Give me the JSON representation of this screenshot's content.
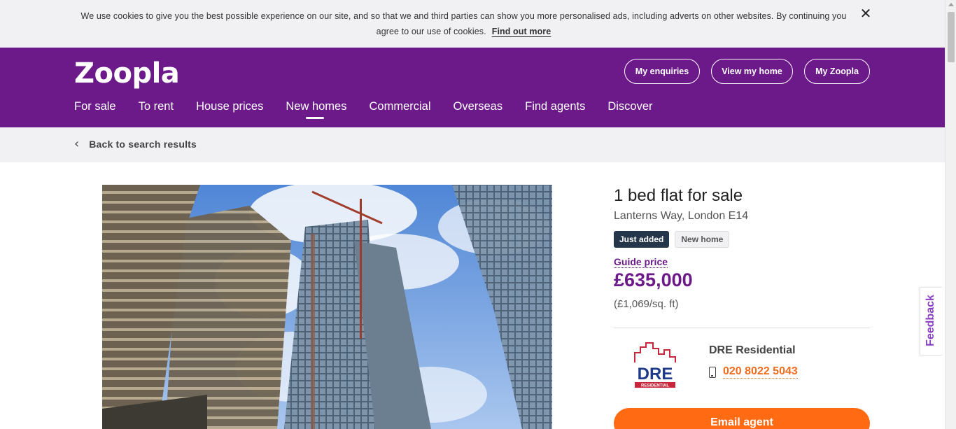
{
  "cookie": {
    "text": "We use cookies to give you the best possible experience on our site, and so that we and third parties can show you more personalised ads, including adverts on other websites. By continuing you agree to our use of cookies.",
    "link": "Find out more",
    "close": "✕"
  },
  "header": {
    "logo": "Zoopla",
    "buttons": [
      "My enquiries",
      "View my home",
      "My Zoopla"
    ],
    "nav": [
      "For sale",
      "To rent",
      "House prices",
      "New homes",
      "Commercial",
      "Overseas",
      "Find agents",
      "Discover"
    ],
    "active_nav": "New homes"
  },
  "breadcrumb": {
    "label": "Back to search results",
    "icon": "chevron-left-icon"
  },
  "listing": {
    "title": "1 bed flat for sale",
    "address": "Lanterns Way, London E14",
    "badges": [
      "Just added",
      "New home"
    ],
    "price_label": "Guide price",
    "price": "£635,000",
    "price_per_sqft": "(£1,069/sq. ft)"
  },
  "agent": {
    "name": "DRE Residential",
    "phone": "020 8022 5043",
    "logo_text": "DRE",
    "logo_subtext": "RESIDENTIAL",
    "email_button": "Email agent"
  },
  "feedback": {
    "label": "Feedback"
  },
  "colors": {
    "brand_purple": "#6c1a8a",
    "accent_orange": "#ff6a13",
    "badge_dark": "#25364a",
    "phone_orange": "#ef6c1e"
  }
}
